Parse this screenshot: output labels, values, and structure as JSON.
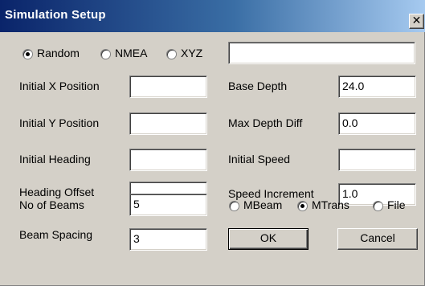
{
  "window": {
    "title": "Simulation Setup",
    "close_glyph": "✕"
  },
  "source_mode": {
    "options": [
      {
        "label": "Random",
        "selected": true
      },
      {
        "label": "NMEA",
        "selected": false
      },
      {
        "label": "XYZ",
        "selected": false
      }
    ],
    "path_value": ""
  },
  "left_fields": [
    {
      "label": "Initial X Position",
      "value": ""
    },
    {
      "label": "Initial Y Position",
      "value": ""
    },
    {
      "label": "Initial Heading",
      "value": ""
    },
    {
      "label": "Heading Offset",
      "value": ""
    },
    {
      "label": "No of Beams",
      "value": "5"
    },
    {
      "label": "Beam Spacing",
      "value": "3"
    }
  ],
  "right_fields": [
    {
      "label": "Base Depth",
      "value": "24.0"
    },
    {
      "label": "Max Depth Diff",
      "value": "0.0"
    },
    {
      "label": "Initial Speed",
      "value": ""
    },
    {
      "label": "Speed Increment",
      "value": "1.0"
    }
  ],
  "output_mode": {
    "options": [
      {
        "label": "MBeam",
        "selected": false
      },
      {
        "label": "MTrans",
        "selected": true
      },
      {
        "label": "File",
        "selected": false
      }
    ]
  },
  "buttons": {
    "ok": "OK",
    "cancel": "Cancel"
  }
}
